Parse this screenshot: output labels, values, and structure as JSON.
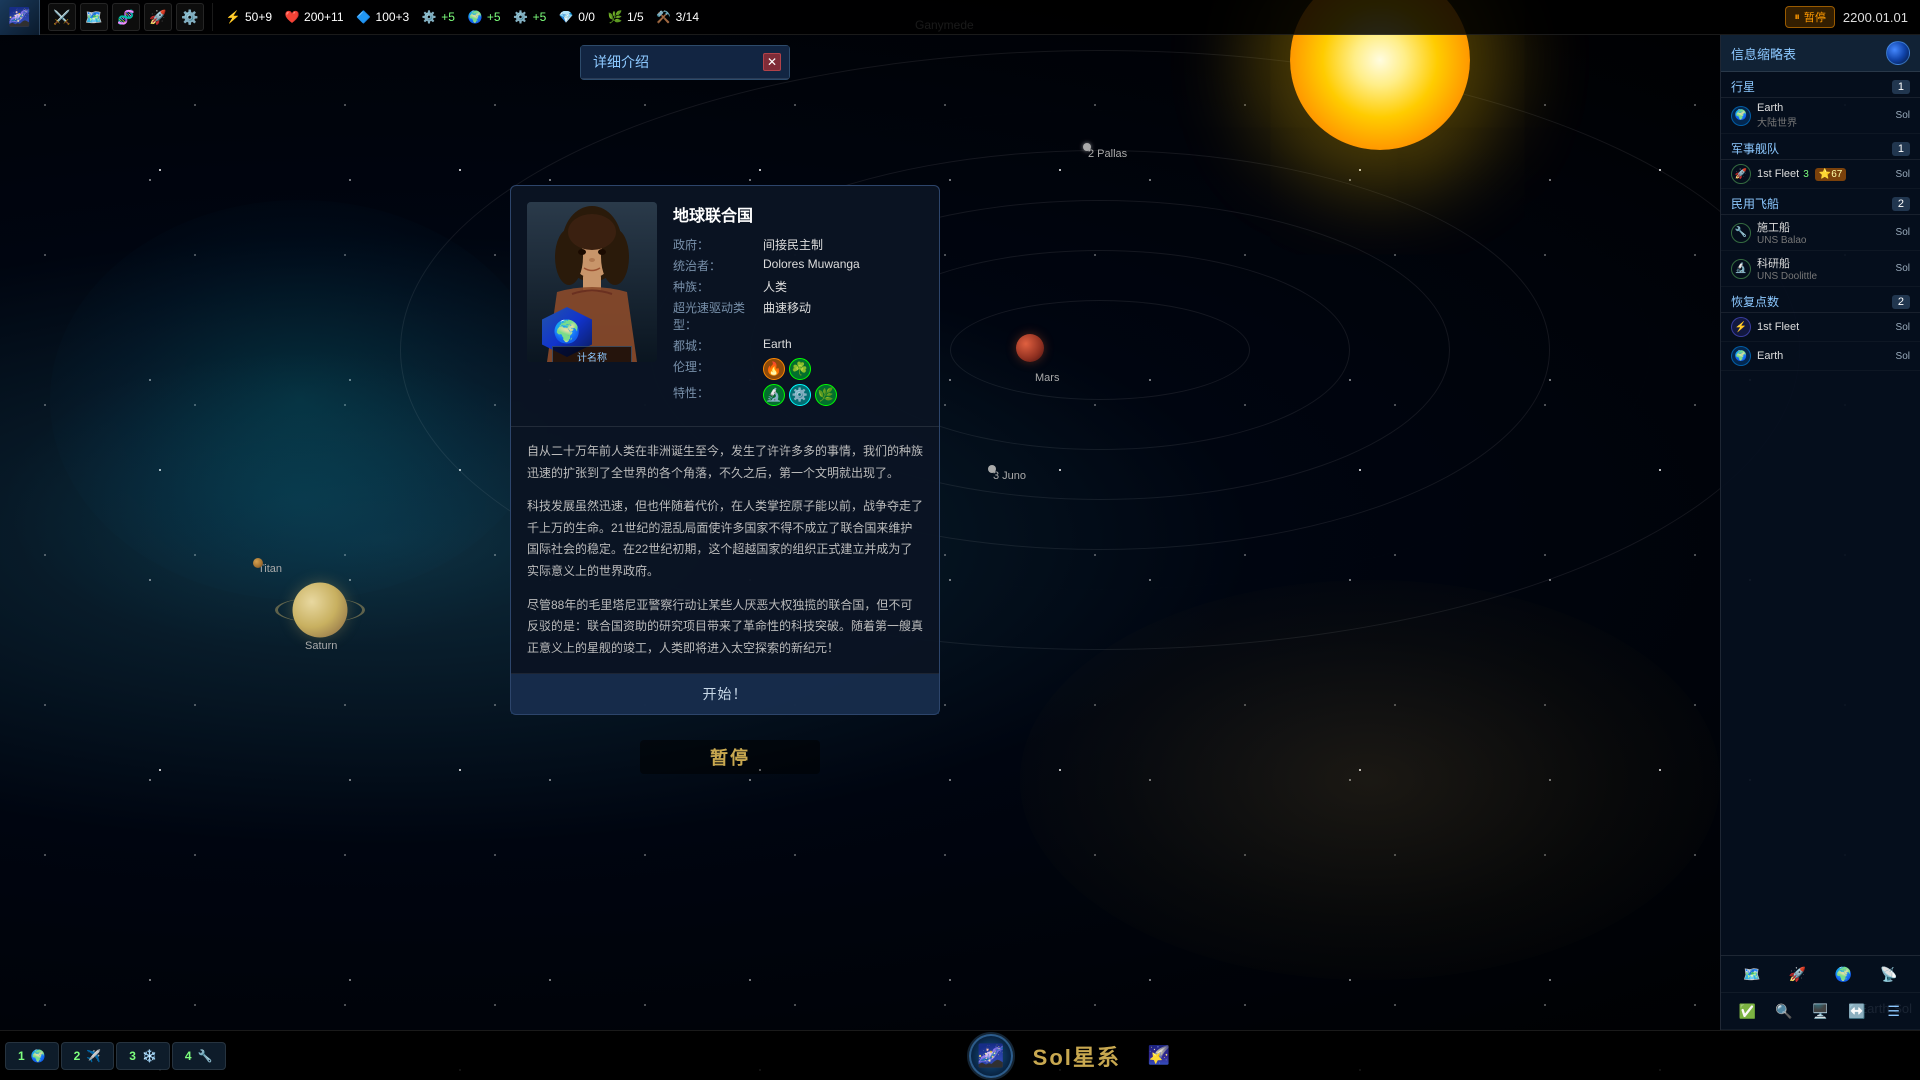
{
  "topbar": {
    "logo_icon": "🌌",
    "action_icons": [
      "⚔️",
      "🗺️",
      "🧬",
      "🚀",
      "⚙️"
    ],
    "resources": [
      {
        "icon": "⚡",
        "color": "#ffd700",
        "value": "50+9"
      },
      {
        "icon": "❤️",
        "color": "#ff4444",
        "value": "200+11"
      },
      {
        "icon": "🔷",
        "color": "#44aaff",
        "value": "100+3"
      },
      {
        "icon": "⚙️",
        "color": "#aaaaaa",
        "value": "+5"
      },
      {
        "icon": "🌍",
        "color": "#44ff44",
        "value": "+5"
      },
      {
        "icon": "⚙️",
        "color": "#aaaaaa",
        "value": "+5"
      },
      {
        "icon": "💎",
        "color": "#aaaaff",
        "value": "0/0"
      },
      {
        "icon": "🌿",
        "color": "#44ff44",
        "value": "1/5"
      },
      {
        "icon": "⚒️",
        "color": "#ffaa44",
        "value": "3/14"
      }
    ],
    "pause_label": "暂停",
    "date": "2200.01.01"
  },
  "right_panel": {
    "title": "信息缩略表",
    "sections": [
      {
        "name": "行星",
        "count": "1",
        "items": [
          {
            "name": "Earth",
            "sub": "大陆世界",
            "loc": "Sol",
            "icon": "🌍"
          }
        ]
      },
      {
        "name": "军事舰队",
        "count": "1",
        "items": [
          {
            "name": "1st Fleet",
            "sub": "3",
            "badge": "67",
            "loc": "Sol",
            "icon": "🚀"
          }
        ]
      },
      {
        "name": "民用飞船",
        "count": "2",
        "items": [
          {
            "name": "施工船",
            "sub": "UNS Balao",
            "loc": "Sol",
            "icon": "🔧"
          },
          {
            "name": "科研船",
            "sub": "UNS Doolittle",
            "loc": "Sol",
            "icon": "🔬"
          }
        ]
      },
      {
        "name": "恢复点数",
        "count": "2",
        "items": [
          {
            "name": "1st Fleet",
            "sub": "",
            "loc": "Sol",
            "icon": "⚡"
          },
          {
            "name": "Earth",
            "sub": "",
            "loc": "Sol",
            "icon": "🌍"
          }
        ]
      }
    ]
  },
  "detail_dialog": {
    "title": "详细介绍"
  },
  "faction": {
    "name": "地球联合国",
    "government_label": "政府：",
    "government_value": "间接民主制",
    "ruler_label": "统治者：",
    "ruler_value": "Dolores Muwanga",
    "species_label": "种族：",
    "species_value": "人类",
    "ftl_label": "超光速驱动类型：",
    "ftl_value": "曲速移动",
    "capital_label": "都城：",
    "capital_value": "Earth",
    "ethics_label": "伦理：",
    "traits_label": "特性：",
    "emblem_icon": "🌍",
    "name_badge": "计名称",
    "lore": [
      "自从二十万年前人类在非洲诞生至今，发生了许许多多的事情，我们的种族迅速的扩张到了全世界的各个角落，不久之后，第一个文明就出现了。",
      "科技发展虽然迅速，但也伴随着代价，在人类掌控原子能以前，战争夺走了千上万的生命。21世纪的混乱局面使许多国家不得不成立了联合国来维护国际社会的稳定。在22世纪初期，这个超越国家的组织正式建立并成为了实际意义上的世界政府。",
      "尽管88年的毛里塔尼亚警察行动让某些人厌恶大权独揽的联合国，但不可反驳的是：联合国资助的研究项目带来了革命性的科技突破。随着第一艘真正意义上的星舰的竣工，人类即将进入太空探索的新纪元！"
    ],
    "start_button": "开始！"
  },
  "map": {
    "ganymede_label": "Ganymede",
    "pallas_label": "2 Pallas",
    "mars_label": "Mars",
    "juno_label": "3 Juno",
    "saturn_label": "Saturn",
    "titan_label": "Titan"
  },
  "bottom": {
    "pause_label": "暂停",
    "system_name": "Sol星系",
    "tabs": [
      {
        "num": "1",
        "icon": "🌍",
        "label": ""
      },
      {
        "num": "2",
        "icon": "✈️",
        "label": ""
      },
      {
        "num": "3",
        "icon": "❄️",
        "label": ""
      },
      {
        "num": "4",
        "icon": "🔧",
        "label": ""
      }
    ]
  },
  "earth_sol_label": "Earth Sol"
}
